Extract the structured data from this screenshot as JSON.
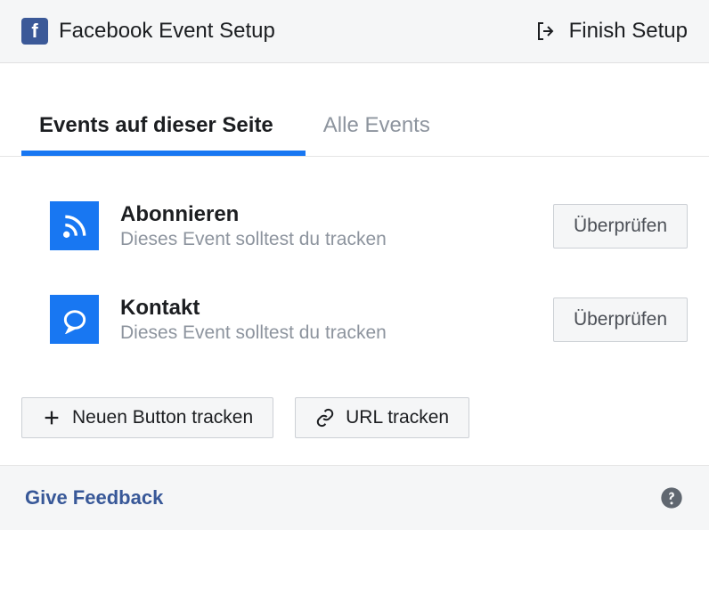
{
  "header": {
    "title": "Facebook Event Setup",
    "finish_label": "Finish Setup"
  },
  "tabs": {
    "events_on_page": "Events auf dieser Seite",
    "all_events": "Alle Events"
  },
  "events": [
    {
      "title": "Abonnieren",
      "desc": "Dieses Event solltest du tracken",
      "verify": "Überprüfen"
    },
    {
      "title": "Kontakt",
      "desc": "Dieses Event solltest du tracken",
      "verify": "Überprüfen"
    }
  ],
  "actions": {
    "track_button": "Neuen Button tracken",
    "track_url": "URL tracken"
  },
  "footer": {
    "feedback": "Give Feedback"
  }
}
